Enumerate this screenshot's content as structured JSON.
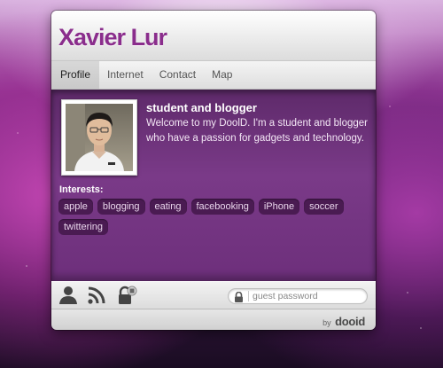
{
  "profile": {
    "name": "Xavier Lur",
    "headline": "student and blogger",
    "bio": "Welcome to my DoolD. I'm a student and blogger who have a passion for gadgets and technology."
  },
  "tabs": [
    {
      "label": "Profile",
      "active": true
    },
    {
      "label": "Internet",
      "active": false
    },
    {
      "label": "Contact",
      "active": false
    },
    {
      "label": "Map",
      "active": false
    }
  ],
  "interests": {
    "label": "Interests:",
    "tags": [
      "apple",
      "blogging",
      "eating",
      "facebooking",
      "iPhone",
      "soccer",
      "twittering"
    ]
  },
  "toolbar": {
    "icons": [
      "person-icon",
      "rss-icon",
      "lock-icon"
    ],
    "password_placeholder": "guest password"
  },
  "footer": {
    "by": "by",
    "brand": "dooid"
  },
  "colors": {
    "accent": "#8a2d8c",
    "panel": "#6d2f7b",
    "tag_bg": "#4a1b52"
  }
}
